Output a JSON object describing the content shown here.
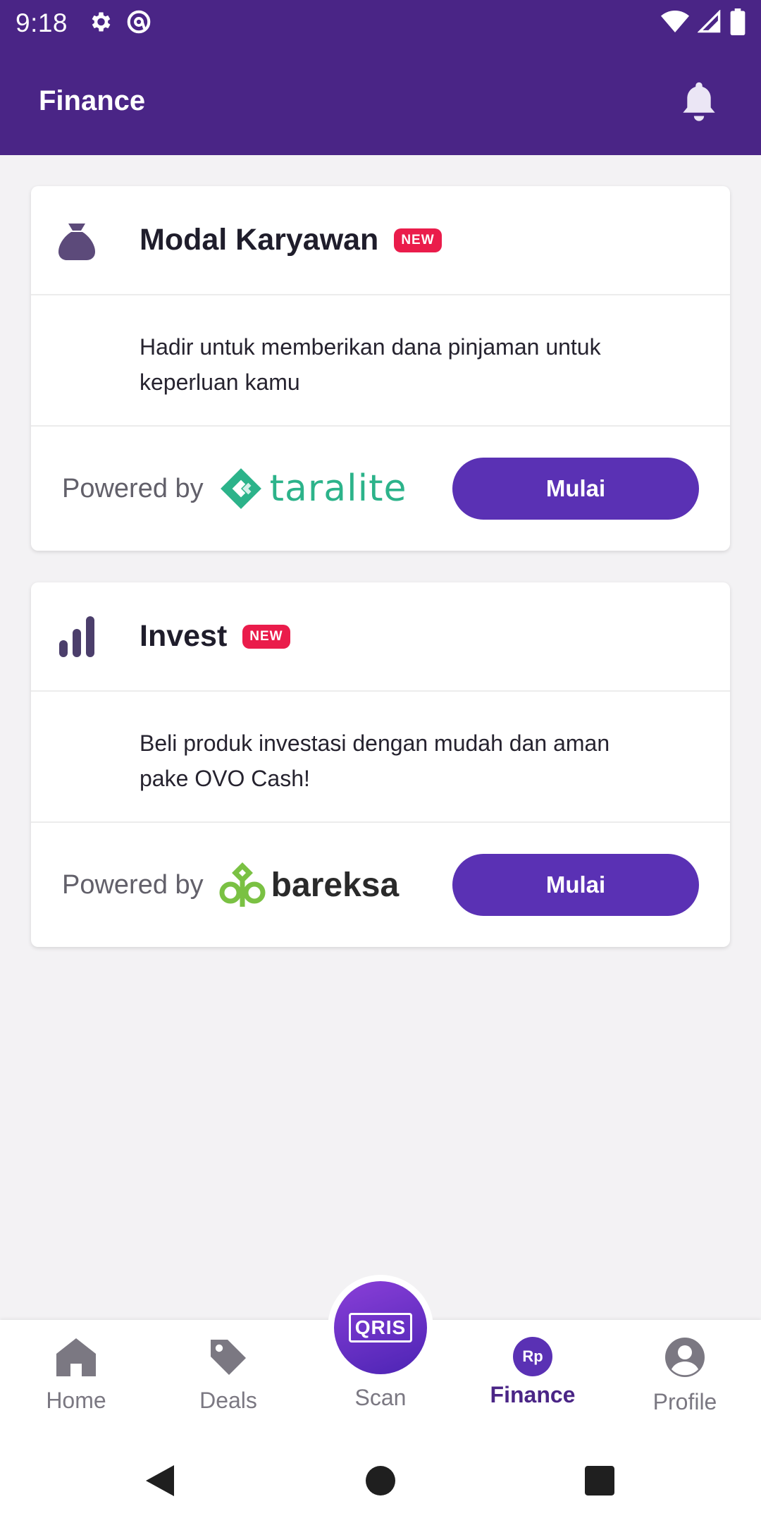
{
  "status_bar": {
    "time": "9:18",
    "icons": [
      "gear-icon",
      "circle-a-icon",
      "wifi-icon",
      "signal-icon",
      "battery-icon"
    ]
  },
  "header": {
    "title": "Finance",
    "notification_icon": "bell-icon"
  },
  "cards": [
    {
      "title": "Modal Karyawan",
      "badge": "NEW",
      "icon": "money-bag-icon",
      "description": "Hadir untuk memberikan dana pinjaman untuk keperluan kamu",
      "powered_by": "Powered by",
      "partner": "taralite",
      "button": "Mulai"
    },
    {
      "title": "Invest",
      "badge": "NEW",
      "icon": "bar-chart-icon",
      "description": "Beli produk investasi dengan mudah dan aman pake OVO Cash!",
      "powered_by": "Powered by",
      "partner": "bareksa",
      "button": "Mulai"
    }
  ],
  "bottom_nav": {
    "items": [
      {
        "label": "Home",
        "icon": "home-icon"
      },
      {
        "label": "Deals",
        "icon": "tag-icon"
      },
      {
        "label": "Scan",
        "icon": "qris-icon",
        "logo_text": "QRIS"
      },
      {
        "label": "Finance",
        "icon": "rp-icon",
        "icon_text": "Rp",
        "active": true
      },
      {
        "label": "Profile",
        "icon": "user-icon"
      }
    ]
  },
  "colors": {
    "primary": "#4a2586",
    "button": "#5a31b4",
    "badge": "#ea1c4b",
    "taralite": "#2cb38a",
    "bareksa_green": "#7ac143"
  }
}
